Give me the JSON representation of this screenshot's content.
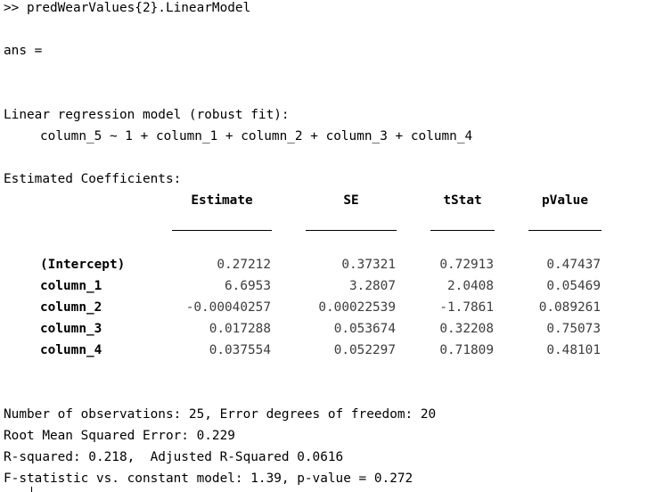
{
  "command_line": ">> predWearValues{2}.LinearModel",
  "ans_line": "ans =",
  "model_title": "Linear regression model (robust fit):",
  "formula": "column_5 ~ 1 + column_1 + column_2 + column_3 + column_4",
  "coef_heading": "Estimated Coefficients:",
  "table": {
    "headers": [
      "Estimate",
      "SE",
      "tStat",
      "pValue"
    ],
    "rows": [
      {
        "name": "(Intercept)",
        "values": [
          "0.27212",
          "0.37321",
          "0.72913",
          "0.47437"
        ]
      },
      {
        "name": "column_1",
        "values": [
          "6.6953",
          "3.2807",
          "2.0408",
          "0.05469"
        ]
      },
      {
        "name": "column_2",
        "values": [
          "-0.00040257",
          "0.00022539",
          "-1.7861",
          "0.089261"
        ]
      },
      {
        "name": "column_3",
        "values": [
          "0.017288",
          "0.053674",
          "0.32208",
          "0.75073"
        ]
      },
      {
        "name": "column_4",
        "values": [
          "0.037554",
          "0.052297",
          "0.71809",
          "0.48101"
        ]
      }
    ]
  },
  "stats": {
    "observations": "Number of observations: 25, Error degrees of freedom: 20",
    "rmse": "Root Mean Squared Error: 0.229",
    "rsquared": "R-squared: 0.218,  Adjusted R-Squared 0.0616",
    "fstat": "F-statistic vs. constant model: 1.39, p-value = 0.272"
  }
}
